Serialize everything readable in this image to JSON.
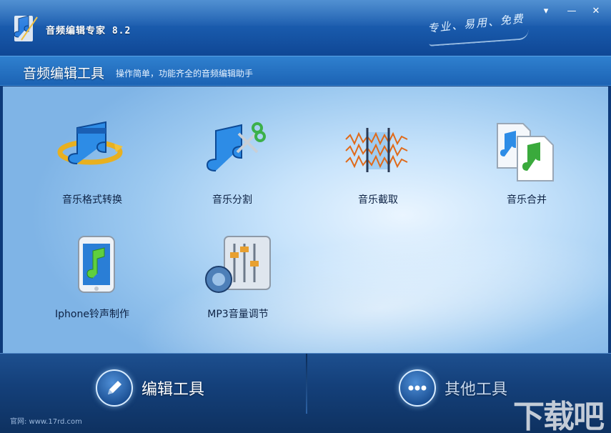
{
  "window": {
    "title": "音频编辑专家 8.2",
    "slogan": "专业、易用、免费",
    "controls": {
      "menu": "▾",
      "minimize": "—",
      "close": "✕"
    }
  },
  "header": {
    "title": "音频编辑工具",
    "description": "操作简单，功能齐全的音频编辑助手"
  },
  "tools": [
    {
      "label": "音乐格式转换",
      "icon": "music-convert-icon"
    },
    {
      "label": "音乐分割",
      "icon": "music-scissors-icon"
    },
    {
      "label": "音乐截取",
      "icon": "waveform-clip-icon"
    },
    {
      "label": "音乐合并",
      "icon": "music-files-merge-icon"
    },
    {
      "label": "Iphone铃声制作",
      "icon": "iphone-ringtone-icon"
    },
    {
      "label": "MP3音量调节",
      "icon": "volume-mixer-icon"
    }
  ],
  "bottom_nav": {
    "edit_tools": "编辑工具",
    "other_tools": "其他工具"
  },
  "footer": {
    "url": "官网: www.17rd.com",
    "watermark": "下载吧"
  },
  "colors": {
    "accent": "#1a5cae",
    "content_bg": "#c7e3fb",
    "bottom_bar": "#14407a"
  }
}
